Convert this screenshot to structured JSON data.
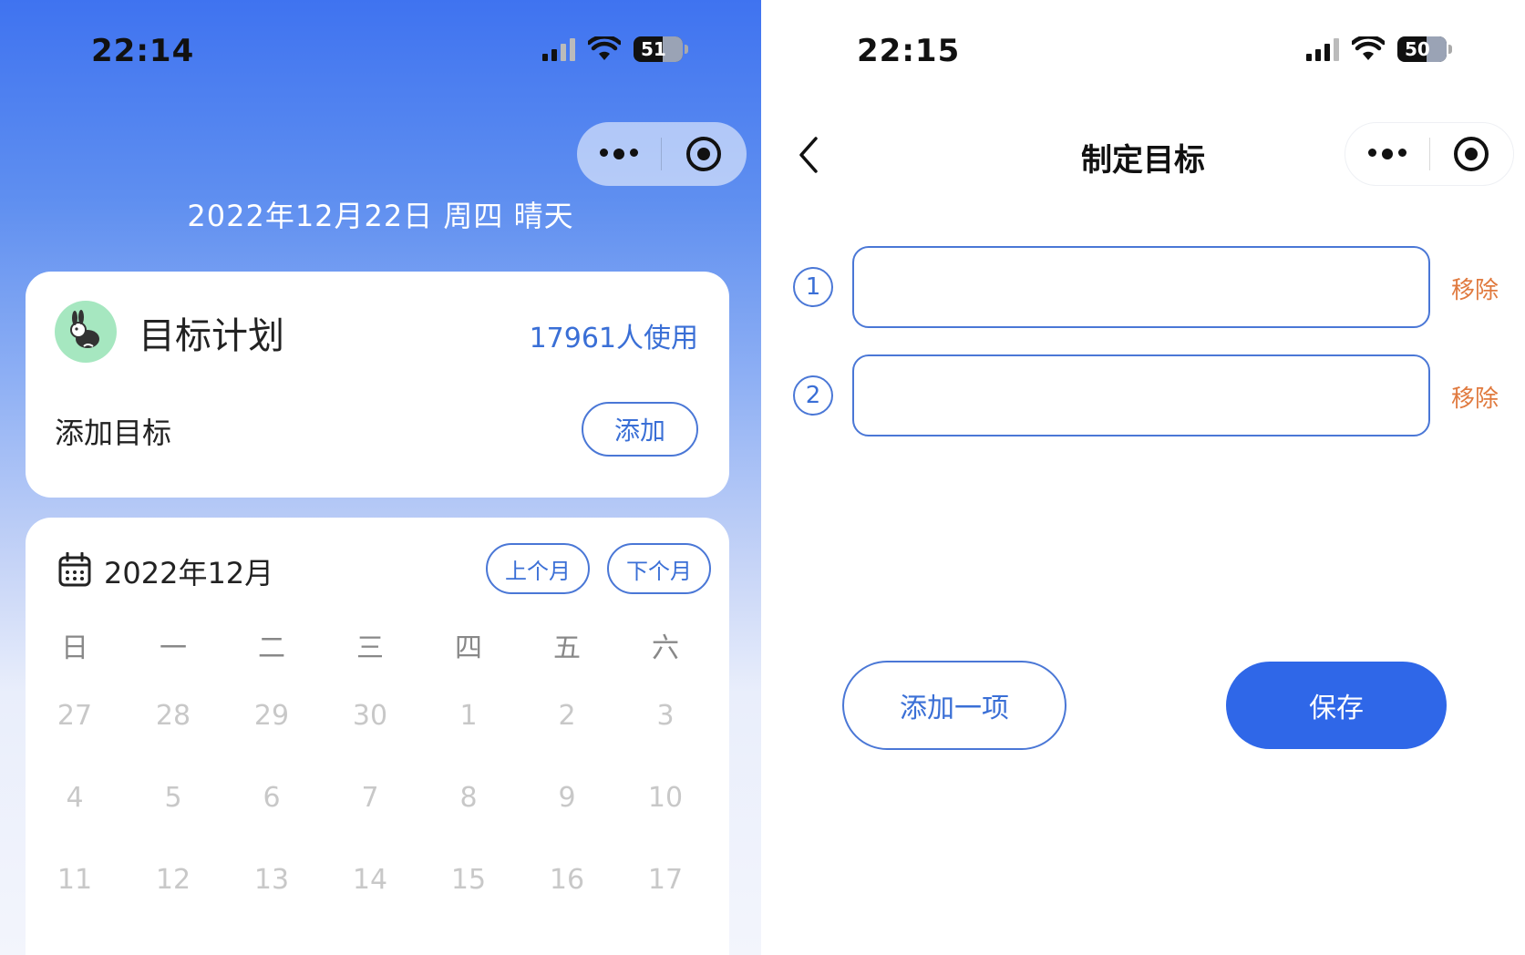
{
  "home": {
    "time": "22:14",
    "battery": "51",
    "date_line": "2022年12月22日 周四 晴天",
    "plan_card": {
      "title": "目标计划",
      "users": "17961人使用",
      "add_label": "添加目标",
      "add_button": "添加"
    },
    "calendar": {
      "month": "2022年12月",
      "prev_button": "上个月",
      "next_button": "下个月",
      "weekdays": [
        "日",
        "一",
        "二",
        "三",
        "四",
        "五",
        "六"
      ],
      "rows": [
        [
          "27",
          "28",
          "29",
          "30",
          "1",
          "2",
          "3"
        ],
        [
          "4",
          "5",
          "6",
          "7",
          "8",
          "9",
          "10"
        ],
        [
          "11",
          "12",
          "13",
          "14",
          "15",
          "16",
          "17"
        ]
      ]
    }
  },
  "goal_page": {
    "time": "22:15",
    "battery": "50",
    "title": "制定目标",
    "items": [
      {
        "number": "1",
        "value": "",
        "remove_label": "移除"
      },
      {
        "number": "2",
        "value": "",
        "remove_label": "移除"
      }
    ],
    "add_item_button": "添加一项",
    "save_button": "保存"
  },
  "colors": {
    "accent": "#2f67e8",
    "outline_blue": "#4a77d6",
    "remove_orange": "#e07a3f",
    "avatar_green": "#a6e7c0"
  },
  "icons": {
    "menu": "more-dots-icon",
    "close": "target-circle-icon",
    "back": "chevron-left-icon",
    "calendar": "calendar-icon",
    "avatar": "rabbit-icon"
  }
}
